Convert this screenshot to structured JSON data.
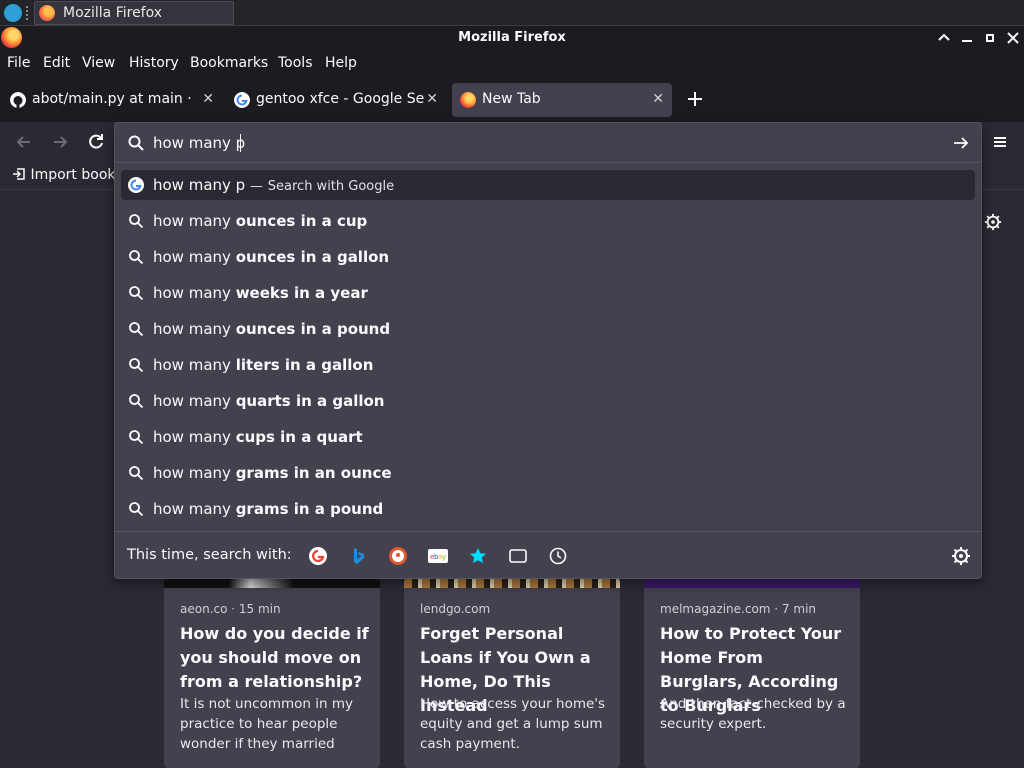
{
  "taskbar": {
    "task_title": "Mozilla Firefox"
  },
  "window": {
    "title": "Mozilla Firefox"
  },
  "menu": {
    "file": "File",
    "edit": "Edit",
    "view": "View",
    "history": "History",
    "bookmarks": "Bookmarks",
    "tools": "Tools",
    "help": "Help"
  },
  "tabs": [
    {
      "label": "abot/main.py at main · Ti",
      "favicon": "github-icon"
    },
    {
      "label": "gentoo xfce - Google Sea",
      "favicon": "google-icon"
    },
    {
      "label": "New Tab",
      "favicon": "firefox-icon"
    }
  ],
  "bookmarks_toolbar": {
    "import_label": "Import book"
  },
  "urlbar": {
    "value": "how many p",
    "first_suggestion": {
      "query": "how many p",
      "separator": "—",
      "action": "Search with Google"
    },
    "suggestions": [
      {
        "prefix": "how many ",
        "bold": "ounces in a cup"
      },
      {
        "prefix": "how many ",
        "bold": "ounces in a gallon"
      },
      {
        "prefix": "how many ",
        "bold": "weeks in a year"
      },
      {
        "prefix": "how many ",
        "bold": "ounces in a pound"
      },
      {
        "prefix": "how many ",
        "bold": "liters in a gallon"
      },
      {
        "prefix": "how many ",
        "bold": "quarts in a gallon"
      },
      {
        "prefix": "how many ",
        "bold": "cups in a quart"
      },
      {
        "prefix": "how many ",
        "bold": "grams in an ounce"
      },
      {
        "prefix": "how many ",
        "bold": "grams in a pound"
      }
    ],
    "one_off_label": "This time, search with:",
    "engines": [
      "google-icon",
      "bing-icon",
      "duckduckgo-icon",
      "ebay-icon",
      "bookmarks-star-icon",
      "tabs-icon",
      "history-clock-icon"
    ]
  },
  "stories": [
    {
      "source": "aeon.co · 15 min",
      "headline": "How do you decide if you should move on from a relationship?",
      "excerpt": "It is not uncommon in my practice to hear people wonder if they married the…"
    },
    {
      "source": "lendgo.com",
      "headline": "Forget Personal Loans if You Own a Home, Do This Instead",
      "excerpt": "How to access your home's equity and get a lump sum cash payment."
    },
    {
      "source": "melmagazine.com · 7 min",
      "headline": "How to Protect Your Home From Burglars, According to Burglars",
      "excerpt": "And then fact-checked by a security expert."
    }
  ],
  "colors": {
    "chrome_bg": "#1c1b22",
    "content_bg": "#2b2a33",
    "popup_bg": "#42414d",
    "accent": "#00ddff"
  }
}
